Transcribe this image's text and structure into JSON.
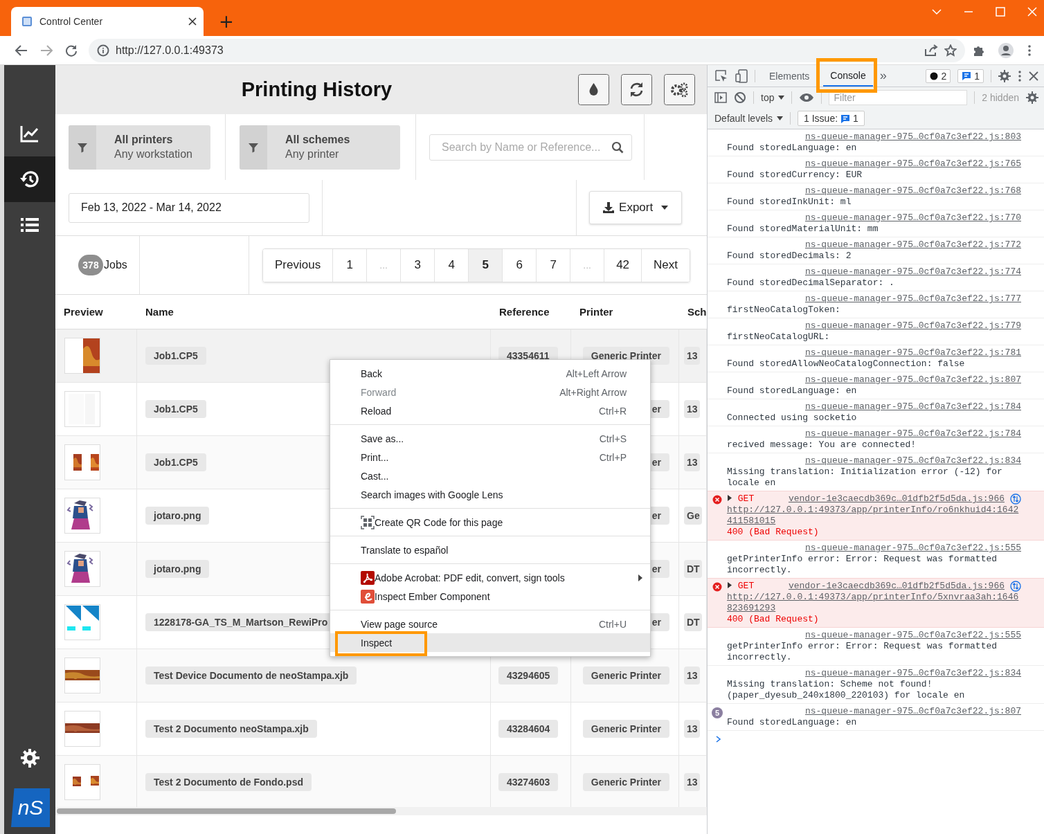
{
  "browser": {
    "tab_title": "Control Center",
    "new_tab": "+",
    "url": "http://127.0.0.1:49373"
  },
  "app": {
    "title": "Printing History",
    "logo": "nS",
    "sidebar": [
      {
        "selected": false
      },
      {
        "selected": true
      },
      {
        "selected": false
      }
    ],
    "filters": [
      {
        "title": "All printers",
        "subtitle": "Any workstation"
      },
      {
        "title": "All schemes",
        "subtitle": "Any printer"
      }
    ],
    "search": {
      "placeholder": "Search by Name or Reference..."
    },
    "date_range": "Feb 13, 2022 - Mar 14, 2022",
    "export_button": "Export",
    "job_count": "378",
    "jobs_label": "Jobs",
    "pagination": [
      {
        "label": "Previous",
        "selected": false,
        "disabled": false
      },
      {
        "label": "1",
        "selected": false,
        "disabled": false
      },
      {
        "label": "...",
        "selected": false,
        "disabled": true
      },
      {
        "label": "3",
        "selected": false,
        "disabled": false
      },
      {
        "label": "4",
        "selected": false,
        "disabled": false
      },
      {
        "label": "5",
        "selected": true,
        "disabled": false
      },
      {
        "label": "6",
        "selected": false,
        "disabled": false
      },
      {
        "label": "7",
        "selected": false,
        "disabled": false
      },
      {
        "label": "...",
        "selected": false,
        "disabled": true
      },
      {
        "label": "42",
        "selected": false,
        "disabled": false
      },
      {
        "label": "Next",
        "selected": false,
        "disabled": false
      }
    ],
    "table": {
      "columns": [
        "Preview",
        "Name",
        "Reference",
        "Printer",
        "Sch"
      ],
      "rows": [
        {
          "name": "Job1.CP5",
          "reference": "43354611",
          "printer": "Generic Printer",
          "column_5": "13"
        },
        {
          "name": "Job1.CP5",
          "printer": "er",
          "column_5": "13"
        },
        {
          "name": "Job1.CP5",
          "printer": "er",
          "column_5": "13"
        },
        {
          "name": "jotaro.png",
          "printer": "er",
          "column_5": "Ge"
        },
        {
          "name": "jotaro.png",
          "printer": "er",
          "column_5": "DT"
        },
        {
          "name": "1228178-GA_TS_M_Martson_RewiPro",
          "printer": "er",
          "column_5": "DT"
        },
        {
          "name": "Test Device Documento de neoStampa.xjb",
          "reference": "43294605",
          "printer": "Generic Printer",
          "column_5": "13"
        },
        {
          "name": "Test 2 Documento neoStampa.xjb",
          "reference": "43284604",
          "printer": "Generic Printer",
          "column_5": "13"
        },
        {
          "name": "Test 2 Documento de Fondo.psd",
          "reference": "43274603",
          "printer": "Generic Printer",
          "column_5": "13"
        }
      ]
    }
  },
  "context_menu": [
    [
      {
        "kind": "plain",
        "label": "Back",
        "shortcut": "Alt+Left Arrow",
        "disabled": false,
        "selected": false,
        "highlighted": false
      },
      {
        "kind": "plain",
        "label": "Forward",
        "shortcut": "Alt+Right Arrow",
        "disabled": true,
        "selected": false,
        "highlighted": false
      },
      {
        "kind": "plain",
        "label": "Reload",
        "shortcut": "Ctrl+R",
        "disabled": false,
        "selected": false,
        "highlighted": false
      }
    ],
    [
      {
        "kind": "plain",
        "label": "Save as...",
        "shortcut": "Ctrl+S",
        "disabled": false,
        "selected": false,
        "highlighted": false
      },
      {
        "kind": "plain",
        "label": "Print...",
        "shortcut": "Ctrl+P",
        "disabled": false,
        "selected": false,
        "highlighted": false
      },
      {
        "kind": "plain",
        "label": "Cast...",
        "disabled": false,
        "selected": false,
        "highlighted": false
      },
      {
        "kind": "plain",
        "label": "Search images with Google Lens",
        "disabled": false,
        "selected": false,
        "highlighted": false
      }
    ],
    [
      {
        "kind": "qr",
        "label": "Create QR Code for this page",
        "disabled": false,
        "selected": false,
        "highlighted": false
      }
    ],
    [
      {
        "kind": "plain",
        "label": "Translate to español",
        "disabled": false,
        "selected": false,
        "highlighted": false
      }
    ],
    [
      {
        "kind": "acrobat",
        "label": "Adobe Acrobat: PDF edit, convert, sign tools",
        "submenu": true,
        "disabled": false,
        "selected": false,
        "highlighted": false
      },
      {
        "kind": "ember",
        "label": "Inspect Ember Component",
        "disabled": false,
        "selected": false,
        "highlighted": false
      }
    ],
    [
      {
        "kind": "plain",
        "label": "View page source",
        "shortcut": "Ctrl+U",
        "disabled": false,
        "selected": false,
        "highlighted": false
      },
      {
        "kind": "plain",
        "label": "Inspect",
        "disabled": false,
        "selected": true,
        "highlighted": true
      }
    ]
  ],
  "devtools": {
    "tabs": [
      {
        "label": "Elements",
        "selected": false,
        "highlighted": false
      },
      {
        "label": "Console",
        "selected": true,
        "highlighted": true
      }
    ],
    "more_tabs": "»",
    "error_count": "2",
    "issue_count": "1",
    "context": "top",
    "filter": {
      "placeholder": "Filter"
    },
    "hidden": "2 hidden",
    "levels": "Default levels",
    "issues_label": "1 Issue:",
    "issues_badge": "1",
    "console": [
      {
        "kind": "log",
        "text": "Found storedLanguage: en",
        "source": "ns-queue-manager-975…0cf0a7c3ef22.js:803"
      },
      {
        "kind": "log",
        "text": "Found storedCurrency: EUR",
        "source": "ns-queue-manager-975…0cf0a7c3ef22.js:765"
      },
      {
        "kind": "log",
        "text": "Found storedInkUnit: ml",
        "source": "ns-queue-manager-975…0cf0a7c3ef22.js:768"
      },
      {
        "kind": "log",
        "text": "Found storedMaterialUnit: mm",
        "source": "ns-queue-manager-975…0cf0a7c3ef22.js:770"
      },
      {
        "kind": "log",
        "text": "Found storedDecimals: 2",
        "source": "ns-queue-manager-975…0cf0a7c3ef22.js:772"
      },
      {
        "kind": "log",
        "text": "Found storedDecimalSeparator: .",
        "source": "ns-queue-manager-975…0cf0a7c3ef22.js:774"
      },
      {
        "kind": "log",
        "text": "firstNeoCatalogToken:",
        "source": "ns-queue-manager-975…0cf0a7c3ef22.js:777"
      },
      {
        "kind": "log",
        "text": "firstNeoCatalogURL:",
        "source": "ns-queue-manager-975…0cf0a7c3ef22.js:779"
      },
      {
        "kind": "log",
        "text": "Found storedAllowNeoCatalogConnection: false",
        "source": "ns-queue-manager-975…0cf0a7c3ef22.js:781"
      },
      {
        "kind": "log",
        "text": "Found storedLanguage: en",
        "source": "ns-queue-manager-975…0cf0a7c3ef22.js:807"
      },
      {
        "kind": "log",
        "text": "Connected using socketio",
        "source": "ns-queue-manager-975…0cf0a7c3ef22.js:784"
      },
      {
        "kind": "log",
        "text": "recived message: You are connected!",
        "source": "ns-queue-manager-975…0cf0a7c3ef22.js:784"
      },
      {
        "kind": "log",
        "text": "Missing translation: Initialization error (-12) for locale en",
        "source": "ns-queue-manager-975…0cf0a7c3ef22.js:834"
      },
      {
        "kind": "error",
        "method": "GET",
        "url": "http://127.0.0.1:49373/app/printerInfo/ro6nkhuid4:1642411581015",
        "status": "400 (Bad Request)",
        "source": "vendor-1e3caecdb369c…01dfb2f5d5da.js:966"
      },
      {
        "kind": "log",
        "text": "getPrinterInfo error: Error: Request was formatted incorrectly.",
        "source": "ns-queue-manager-975…0cf0a7c3ef22.js:555"
      },
      {
        "kind": "error",
        "method": "GET",
        "url": "http://127.0.0.1:49373/app/printerInfo/5xnvraa3ah:1646823691293",
        "status": "400 (Bad Request)",
        "source": "vendor-1e3caecdb369c…01dfb2f5d5da.js:966"
      },
      {
        "kind": "log",
        "text": "getPrinterInfo error: Error: Request was formatted incorrectly.",
        "source": "ns-queue-manager-975…0cf0a7c3ef22.js:555"
      },
      {
        "kind": "log",
        "text": "Missing translation: Scheme not found! (paper_dyesub_240x1800_220103) for locale en",
        "source": "ns-queue-manager-975…0cf0a7c3ef22.js:834"
      },
      {
        "kind": "log",
        "count": "5",
        "text": "Found storedLanguage: en",
        "source": "ns-queue-manager-975…0cf0a7c3ef22.js:807"
      }
    ]
  }
}
